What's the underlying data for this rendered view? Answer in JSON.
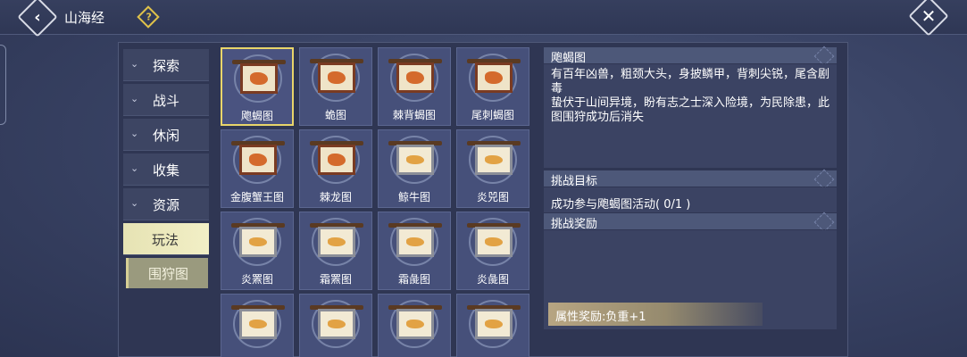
{
  "header": {
    "title": "山海经",
    "back_icon": "chevron-left-icon",
    "help_icon": "question-icon",
    "close_icon": "close-icon"
  },
  "sidebar": {
    "items": [
      {
        "label": "探索"
      },
      {
        "label": "战斗"
      },
      {
        "label": "休闲"
      },
      {
        "label": "收集"
      },
      {
        "label": "资源"
      },
      {
        "label": "玩法"
      }
    ],
    "active_index": 5,
    "sub_items": [
      {
        "label": "围狩图"
      }
    ]
  },
  "grid": {
    "items": [
      {
        "name": "飑蝎图",
        "style": "dark"
      },
      {
        "name": "蛫图",
        "style": "dark"
      },
      {
        "name": "棘背蝎图",
        "style": "dark"
      },
      {
        "name": "尾刺蝎图",
        "style": "dark"
      },
      {
        "name": "金腹蟹王图",
        "style": "dark"
      },
      {
        "name": "棘龙图",
        "style": "dark"
      },
      {
        "name": "鲸牛图",
        "style": "light"
      },
      {
        "name": "炎兕图",
        "style": "light"
      },
      {
        "name": "炎罴图",
        "style": "light"
      },
      {
        "name": "霜罴图",
        "style": "light"
      },
      {
        "name": "霜彘图",
        "style": "light"
      },
      {
        "name": "炎彘图",
        "style": "light"
      },
      {
        "name": "",
        "style": "light"
      },
      {
        "name": "",
        "style": "light"
      },
      {
        "name": "",
        "style": "light"
      },
      {
        "name": "",
        "style": "light"
      }
    ],
    "selected_index": 0
  },
  "info": {
    "title": "飑蝎图",
    "description": "有百年凶兽，粗颈大头，身披鳞甲，背刺尖锐，尾含剧毒\n蛰伏于山间异境，盼有志之士深入险境，为民除患，此图围狩成功后消失",
    "goal_header": "挑战目标",
    "goal_text": "成功参与飑蝎图活动( 0/1 )",
    "reward_header": "挑战奖励",
    "reward_text": "属性奖励:负重+1"
  },
  "colors": {
    "selected_border": "#e9d56a",
    "active_tab": "#f2efc6"
  }
}
